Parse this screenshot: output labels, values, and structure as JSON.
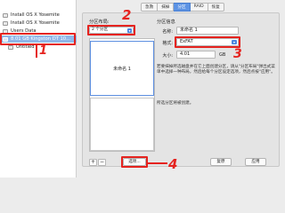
{
  "sidebar": {
    "items": [
      {
        "label": "Install OS X Yosemite",
        "icon": "disk-icon"
      },
      {
        "label": "Install OS X Yosemite",
        "icon": "disk-icon"
      },
      {
        "label": "Users Data",
        "icon": "disk-icon"
      },
      {
        "label": "8.01 GB Kingston DT 10...",
        "icon": "usb-drive-icon"
      },
      {
        "label": "Untitled",
        "icon": "disk-icon"
      }
    ],
    "selected_index": 3
  },
  "tabs": [
    {
      "label": "急救"
    },
    {
      "label": "抹掉"
    },
    {
      "label": "分区"
    },
    {
      "label": "RAID"
    },
    {
      "label": "恢复"
    }
  ],
  "active_tab_index": 2,
  "layout_section": {
    "title": "分区布局:",
    "scheme_value": "2 个分区",
    "partitions": [
      {
        "label": "未命名 1"
      },
      {
        "label": ""
      }
    ],
    "add_label": "+",
    "remove_label": "−"
  },
  "info_section": {
    "title": "分区信息",
    "name_label": "名称:",
    "name_value": "未命名 1",
    "format_label": "格式:",
    "format_value": "ExFAT",
    "size_label": "大小:",
    "size_value": "4.01",
    "size_unit": "GB",
    "description": "若要抹掉所选磁盘并在它上面创建分区，请从\"分区布局\"弹出式菜单中选择一种布局，然后给每个分区设定选项，然后点按\"应用\"。",
    "status": "所选分区将被创建。"
  },
  "buttons": {
    "options": "选项...",
    "revert": "复原",
    "apply": "应用"
  },
  "annotations": {
    "color": "#e5231f",
    "labels": [
      "1",
      "2",
      "3",
      "4"
    ]
  }
}
